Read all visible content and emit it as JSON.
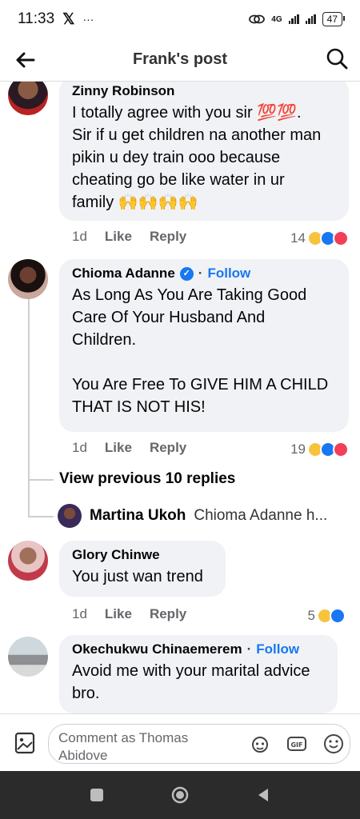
{
  "status": {
    "time": "11:33",
    "x_icon": "x-logo-icon",
    "more": "···",
    "network": "4G",
    "battery": "47"
  },
  "header": {
    "title": "Frank's post"
  },
  "comments": [
    {
      "name": "Zinny Robinson",
      "text": "I totally agree with you sir 💯💯.\nSir if u get children na another man\npikin u dey train ooo because\ncheating go be like water in ur\nfamily 🙌🙌🙌🙌",
      "time": "1d",
      "like": "Like",
      "reply": "Reply",
      "reaction_count": "14"
    },
    {
      "name": "Chioma Adanne",
      "verified": "✓",
      "dot": "·",
      "follow": "Follow",
      "text": "As Long As You Are Taking Good\nCare Of Your Husband And\nChildren.\n\nYou Are Free To GIVE HIM A CHILD\nTHAT IS NOT HIS!",
      "time": "1d",
      "like": "Like",
      "reply": "Reply",
      "reaction_count": "19"
    },
    {
      "name": "Glory Chinwe",
      "text": "You just wan trend",
      "time": "1d",
      "like": "Like",
      "reply": "Reply",
      "reaction_count": "5"
    },
    {
      "name": "Okechukwu Chinaemerem",
      "dot": "·",
      "follow": "Follow",
      "text": "Avoid me with your marital advice\nbro."
    }
  ],
  "thread": {
    "view_previous": "View previous 10 replies",
    "reply_preview_name": "Martina Ukoh",
    "reply_preview_text": "Chioma Adanne h..."
  },
  "composer": {
    "placeholder": "Comment as Thomas\nAbidove"
  },
  "colors": {
    "accent": "#1877f2",
    "bubble": "#f0f2f5",
    "meta": "#65676b",
    "navbar": "#2b2b2b"
  }
}
